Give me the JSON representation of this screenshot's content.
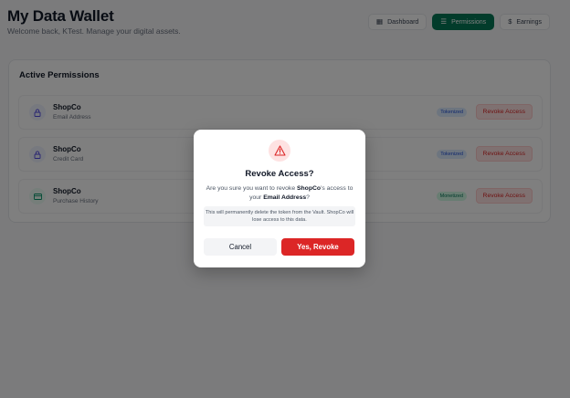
{
  "header": {
    "title": "My Data Wallet",
    "subtitle": "Welcome back, KTest. Manage your digital assets."
  },
  "nav": [
    {
      "label": "Dashboard",
      "icon": "grid-icon",
      "active": false
    },
    {
      "label": "Permissions",
      "icon": "list-icon",
      "active": true
    },
    {
      "label": "Earnings",
      "icon": "dollar-icon",
      "active": false
    }
  ],
  "permissions": {
    "title": "Active Permissions",
    "items": [
      {
        "company": "ShopCo",
        "item": "Email Address",
        "badge": "Tokenized",
        "action": "Revoke Access",
        "icon": "lock-icon"
      },
      {
        "company": "ShopCo",
        "item": "Credit Card",
        "badge": "Tokenized",
        "action": "Revoke Access",
        "icon": "lock-icon"
      },
      {
        "company": "ShopCo",
        "item": "Purchase History",
        "badge": "Monetized",
        "action": "Revoke Access",
        "icon": "card-icon"
      }
    ]
  },
  "modal": {
    "title": "Revoke Access?",
    "text_prefix": "Are you sure you want to revoke ",
    "company": "ShopCo",
    "text_mid": "'s access to your ",
    "item": "Email Address",
    "text_suffix": "?",
    "note": "This will permanently delete the token from the Vault. ShopCo will lose access to this data.",
    "cancel_label": "Cancel",
    "confirm_label": "Yes, Revoke"
  },
  "colors": {
    "accent": "#047857",
    "danger": "#dc2626"
  }
}
